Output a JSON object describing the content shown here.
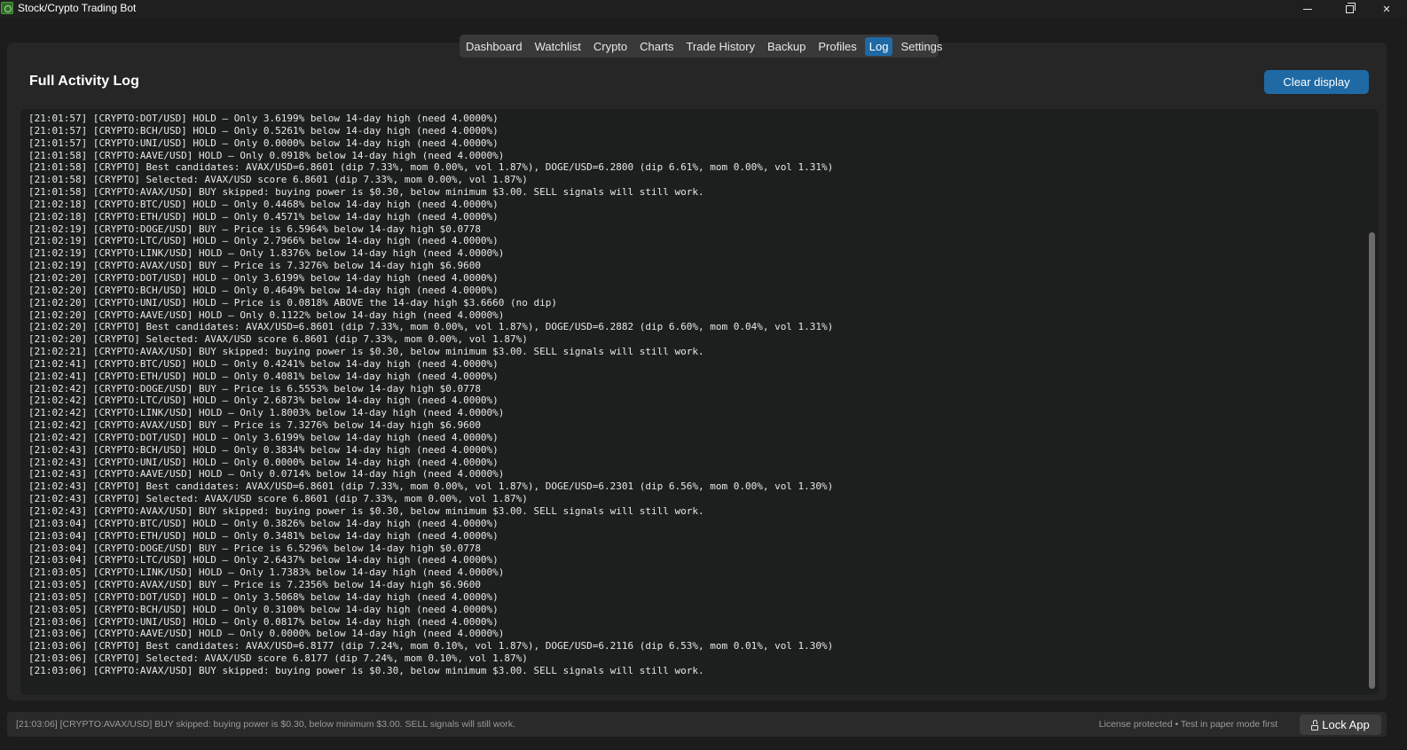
{
  "window": {
    "title": "Stock/Crypto Trading Bot"
  },
  "tabs": [
    {
      "label": "Dashboard",
      "active": false
    },
    {
      "label": "Watchlist",
      "active": false
    },
    {
      "label": "Crypto",
      "active": false
    },
    {
      "label": "Charts",
      "active": false
    },
    {
      "label": "Trade History",
      "active": false
    },
    {
      "label": "Backup",
      "active": false
    },
    {
      "label": "Profiles",
      "active": false
    },
    {
      "label": "Log",
      "active": true
    },
    {
      "label": "Settings",
      "active": false
    }
  ],
  "log_page": {
    "title": "Full Activity Log",
    "clear_button_label": "Clear display",
    "lines": [
      "[21:01:57] [CRYPTO:DOT/USD] HOLD — Only 3.6199% below 14-day high (need 4.0000%)",
      "[21:01:57] [CRYPTO:BCH/USD] HOLD — Only 0.5261% below 14-day high (need 4.0000%)",
      "[21:01:57] [CRYPTO:UNI/USD] HOLD — Only 0.0000% below 14-day high (need 4.0000%)",
      "[21:01:58] [CRYPTO:AAVE/USD] HOLD — Only 0.0918% below 14-day high (need 4.0000%)",
      "[21:01:58] [CRYPTO] Best candidates: AVAX/USD=6.8601 (dip 7.33%, mom 0.00%, vol 1.87%), DOGE/USD=6.2800 (dip 6.61%, mom 0.00%, vol 1.31%)",
      "[21:01:58] [CRYPTO] Selected: AVAX/USD score 6.8601 (dip 7.33%, mom 0.00%, vol 1.87%)",
      "[21:01:58] [CRYPTO:AVAX/USD] BUY skipped: buying power is $0.30, below minimum $3.00. SELL signals will still work.",
      "[21:02:18] [CRYPTO:BTC/USD] HOLD — Only 0.4468% below 14-day high (need 4.0000%)",
      "[21:02:18] [CRYPTO:ETH/USD] HOLD — Only 0.4571% below 14-day high (need 4.0000%)",
      "[21:02:19] [CRYPTO:DOGE/USD] BUY — Price is 6.5964% below 14-day high $0.0778",
      "[21:02:19] [CRYPTO:LTC/USD] HOLD — Only 2.7966% below 14-day high (need 4.0000%)",
      "[21:02:19] [CRYPTO:LINK/USD] HOLD — Only 1.8376% below 14-day high (need 4.0000%)",
      "[21:02:19] [CRYPTO:AVAX/USD] BUY — Price is 7.3276% below 14-day high $6.9600",
      "[21:02:20] [CRYPTO:DOT/USD] HOLD — Only 3.6199% below 14-day high (need 4.0000%)",
      "[21:02:20] [CRYPTO:BCH/USD] HOLD — Only 0.4649% below 14-day high (need 4.0000%)",
      "[21:02:20] [CRYPTO:UNI/USD] HOLD — Price is 0.0818% ABOVE the 14-day high $3.6660 (no dip)",
      "[21:02:20] [CRYPTO:AAVE/USD] HOLD — Only 0.1122% below 14-day high (need 4.0000%)",
      "[21:02:20] [CRYPTO] Best candidates: AVAX/USD=6.8601 (dip 7.33%, mom 0.00%, vol 1.87%), DOGE/USD=6.2882 (dip 6.60%, mom 0.04%, vol 1.31%)",
      "[21:02:20] [CRYPTO] Selected: AVAX/USD score 6.8601 (dip 7.33%, mom 0.00%, vol 1.87%)",
      "[21:02:21] [CRYPTO:AVAX/USD] BUY skipped: buying power is $0.30, below minimum $3.00. SELL signals will still work.",
      "[21:02:41] [CRYPTO:BTC/USD] HOLD — Only 0.4241% below 14-day high (need 4.0000%)",
      "[21:02:41] [CRYPTO:ETH/USD] HOLD — Only 0.4081% below 14-day high (need 4.0000%)",
      "[21:02:42] [CRYPTO:DOGE/USD] BUY — Price is 6.5553% below 14-day high $0.0778",
      "[21:02:42] [CRYPTO:LTC/USD] HOLD — Only 2.6873% below 14-day high (need 4.0000%)",
      "[21:02:42] [CRYPTO:LINK/USD] HOLD — Only 1.8003% below 14-day high (need 4.0000%)",
      "[21:02:42] [CRYPTO:AVAX/USD] BUY — Price is 7.3276% below 14-day high $6.9600",
      "[21:02:42] [CRYPTO:DOT/USD] HOLD — Only 3.6199% below 14-day high (need 4.0000%)",
      "[21:02:43] [CRYPTO:BCH/USD] HOLD — Only 0.3834% below 14-day high (need 4.0000%)",
      "[21:02:43] [CRYPTO:UNI/USD] HOLD — Only 0.0000% below 14-day high (need 4.0000%)",
      "[21:02:43] [CRYPTO:AAVE/USD] HOLD — Only 0.0714% below 14-day high (need 4.0000%)",
      "[21:02:43] [CRYPTO] Best candidates: AVAX/USD=6.8601 (dip 7.33%, mom 0.00%, vol 1.87%), DOGE/USD=6.2301 (dip 6.56%, mom 0.00%, vol 1.30%)",
      "[21:02:43] [CRYPTO] Selected: AVAX/USD score 6.8601 (dip 7.33%, mom 0.00%, vol 1.87%)",
      "[21:02:43] [CRYPTO:AVAX/USD] BUY skipped: buying power is $0.30, below minimum $3.00. SELL signals will still work.",
      "[21:03:04] [CRYPTO:BTC/USD] HOLD — Only 0.3826% below 14-day high (need 4.0000%)",
      "[21:03:04] [CRYPTO:ETH/USD] HOLD — Only 0.3481% below 14-day high (need 4.0000%)",
      "[21:03:04] [CRYPTO:DOGE/USD] BUY — Price is 6.5296% below 14-day high $0.0778",
      "[21:03:04] [CRYPTO:LTC/USD] HOLD — Only 2.6437% below 14-day high (need 4.0000%)",
      "[21:03:05] [CRYPTO:LINK/USD] HOLD — Only 1.7383% below 14-day high (need 4.0000%)",
      "[21:03:05] [CRYPTO:AVAX/USD] BUY — Price is 7.2356% below 14-day high $6.9600",
      "[21:03:05] [CRYPTO:DOT/USD] HOLD — Only 3.5068% below 14-day high (need 4.0000%)",
      "[21:03:05] [CRYPTO:BCH/USD] HOLD — Only 0.3100% below 14-day high (need 4.0000%)",
      "[21:03:06] [CRYPTO:UNI/USD] HOLD — Only 0.0817% below 14-day high (need 4.0000%)",
      "[21:03:06] [CRYPTO:AAVE/USD] HOLD — Only 0.0000% below 14-day high (need 4.0000%)",
      "[21:03:06] [CRYPTO] Best candidates: AVAX/USD=6.8177 (dip 7.24%, mom 0.10%, vol 1.87%), DOGE/USD=6.2116 (dip 6.53%, mom 0.01%, vol 1.30%)",
      "[21:03:06] [CRYPTO] Selected: AVAX/USD score 6.8177 (dip 7.24%, mom 0.10%, vol 1.87%)",
      "[21:03:06] [CRYPTO:AVAX/USD] BUY skipped: buying power is $0.30, below minimum $3.00. SELL signals will still work."
    ]
  },
  "status_bar": {
    "last_message": "[21:03:06] [CRYPTO:AVAX/USD] BUY skipped: buying power is $0.30, below minimum $3.00. SELL signals will still work.",
    "license_text": "License protected • Test in paper mode first",
    "lock_button_label": "Lock App"
  },
  "colors": {
    "accent": "#1f6aa5",
    "background": "#1c1c1c",
    "panel": "#262626",
    "log_background": "#1d1e1e"
  },
  "icons": [
    "app-logo-icon",
    "minimize-icon",
    "maximize-icon",
    "close-icon",
    "lock-icon"
  ]
}
